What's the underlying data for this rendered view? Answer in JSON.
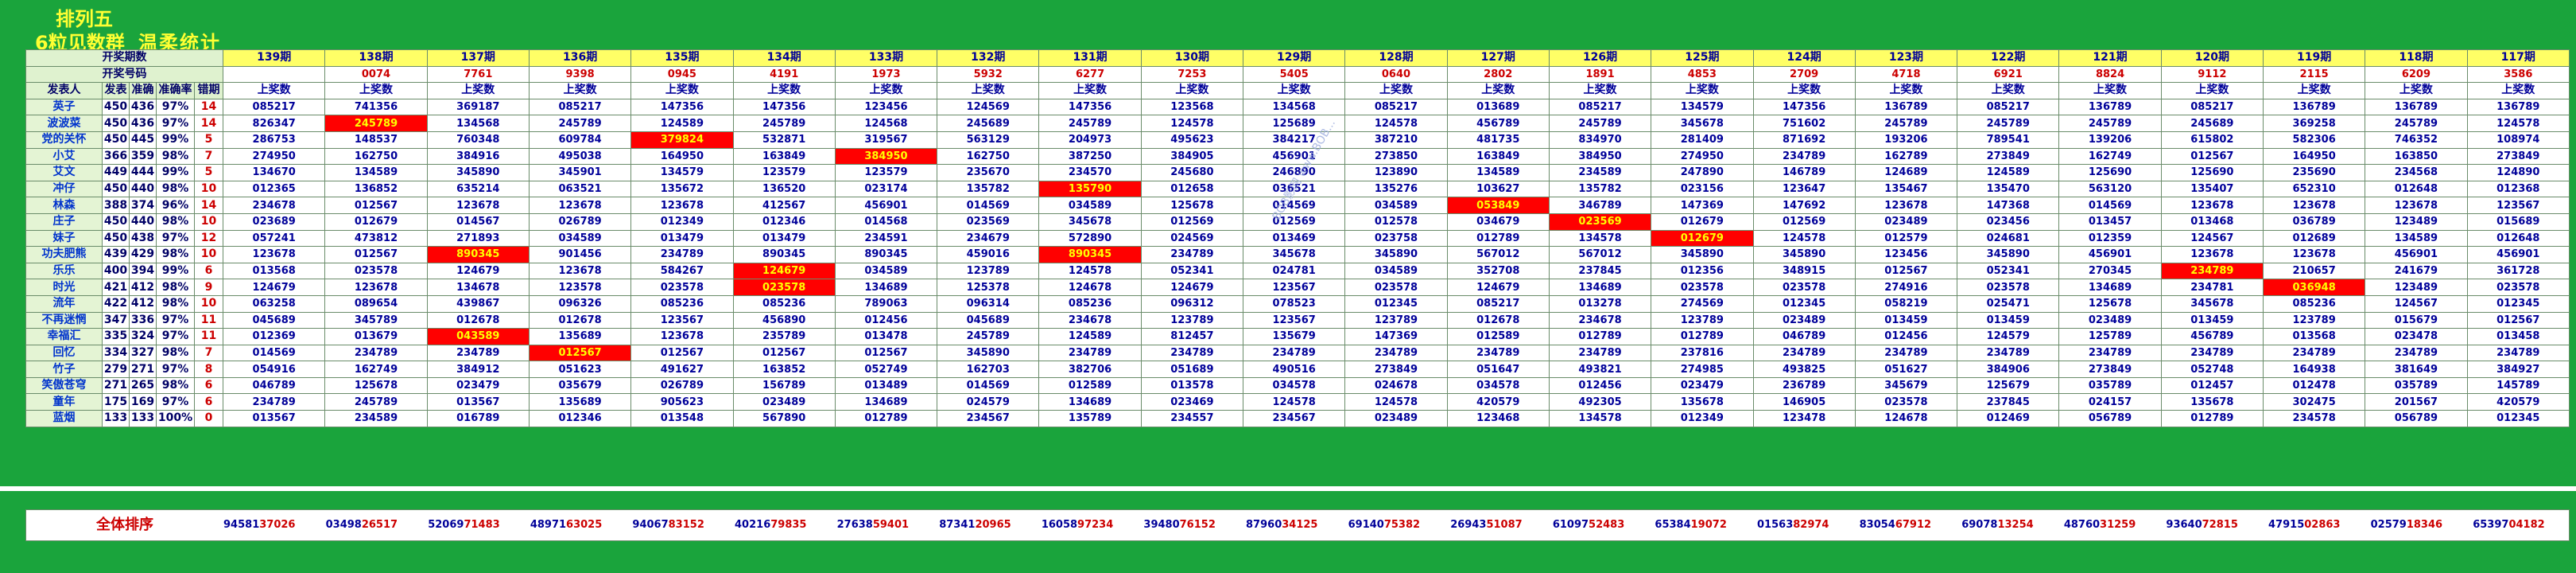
{
  "header": {
    "title_line1": "排列五",
    "title_line2": "6粒见数群",
    "subtitle": "温柔统计"
  },
  "labels": {
    "kaijiang_qishu": "开奖期数",
    "kaijiang_haoma": "开奖号码",
    "publisher": "发表人",
    "stat_cols": [
      "发表",
      "准确",
      "准确率",
      "错期"
    ],
    "shangjiang": "上奖数",
    "overall": "全体排序"
  },
  "periods": [
    "139期",
    "138期",
    "137期",
    "136期",
    "135期",
    "134期",
    "133期",
    "132期",
    "131期",
    "130期",
    "129期",
    "128期",
    "127期",
    "126期",
    "125期",
    "124期",
    "123期",
    "122期",
    "121期",
    "120期",
    "119期",
    "118期",
    "117期"
  ],
  "draws": [
    "",
    "0074",
    "7761",
    "9398",
    "0945",
    "4191",
    "1973",
    "5932",
    "6277",
    "7253",
    "5405",
    "0640",
    "2802",
    "1891",
    "4853",
    "2709",
    "4718",
    "6921",
    "8824",
    "9112",
    "2115",
    "6209",
    "3586"
  ],
  "rows": [
    {
      "name": "英子",
      "s": [
        "450",
        "436",
        "97%",
        "14"
      ],
      "d": [
        "085217",
        "741356",
        "369187",
        "085217",
        "147356",
        "147356",
        "123456",
        "124569",
        "147356",
        "123568",
        "134568",
        "085217",
        "013689",
        "085217",
        "134579",
        "147356",
        "136789",
        "085217",
        "136789",
        "085217",
        "136789",
        "136789",
        "136789"
      ]
    },
    {
      "name": "波波菜",
      "s": [
        "450",
        "436",
        "97%",
        "14"
      ],
      "d": [
        "826347",
        "245789",
        "134568",
        "245789",
        "124589",
        "245789",
        "124568",
        "245689",
        "245789",
        "124578",
        "125689",
        "124578",
        "456789",
        "245789",
        "345678",
        "751602",
        "245789",
        "245789",
        "245789",
        "245689",
        "369258",
        "245789",
        "124578"
      ]
    },
    {
      "name": "党的关怀",
      "s": [
        "450",
        "445",
        "99%",
        "5"
      ],
      "d": [
        "286753",
        "148537",
        "760348",
        "609784",
        "379824",
        "532871",
        "319567",
        "563129",
        "204973",
        "495623",
        "384217",
        "387210",
        "481735",
        "834970",
        "281409",
        "871692",
        "193206",
        "789541",
        "139206",
        "615802",
        "582306",
        "746352",
        "108974"
      ]
    },
    {
      "name": "小艾",
      "s": [
        "366",
        "359",
        "98%",
        "7"
      ],
      "d": [
        "274950",
        "162750",
        "384916",
        "495038",
        "164950",
        "163849",
        "384950",
        "162750",
        "387250",
        "384905",
        "456901",
        "273850",
        "163849",
        "384950",
        "274950",
        "234789",
        "162789",
        "273849",
        "162749",
        "012567",
        "164950",
        "163850",
        "273849"
      ]
    },
    {
      "name": "艾文",
      "s": [
        "449",
        "444",
        "99%",
        "5"
      ],
      "d": [
        "134670",
        "134589",
        "345890",
        "345901",
        "134579",
        "123579",
        "123579",
        "235670",
        "234570",
        "245680",
        "246890",
        "123890",
        "134589",
        "234589",
        "247890",
        "146789",
        "124689",
        "124589",
        "125690",
        "125690",
        "235690",
        "234568",
        "124890"
      ]
    },
    {
      "name": "冲仔",
      "s": [
        "450",
        "440",
        "98%",
        "10"
      ],
      "d": [
        "012365",
        "136852",
        "635214",
        "063521",
        "135672",
        "136520",
        "023174",
        "135782",
        "135790",
        "012658",
        "036521",
        "135276",
        "103627",
        "135782",
        "023156",
        "123647",
        "135467",
        "135470",
        "563120",
        "135407",
        "652310",
        "012648",
        "012368"
      ]
    },
    {
      "name": "林森",
      "s": [
        "388",
        "374",
        "96%",
        "14"
      ],
      "d": [
        "234678",
        "012567",
        "123678",
        "123678",
        "123678",
        "412567",
        "456901",
        "014569",
        "034589",
        "125678",
        "014569",
        "034589",
        "053849",
        "346789",
        "147369",
        "147692",
        "123678",
        "147368",
        "014569",
        "123678",
        "123678",
        "123678",
        "123567"
      ]
    },
    {
      "name": "庄子",
      "s": [
        "450",
        "440",
        "98%",
        "10"
      ],
      "d": [
        "023689",
        "012679",
        "014567",
        "026789",
        "012349",
        "012346",
        "014568",
        "023569",
        "345678",
        "012569",
        "012569",
        "012578",
        "034679",
        "023569",
        "012679",
        "012569",
        "023489",
        "023456",
        "013457",
        "013468",
        "036789",
        "123489",
        "015689"
      ]
    },
    {
      "name": "妹子",
      "s": [
        "450",
        "438",
        "97%",
        "12"
      ],
      "d": [
        "057241",
        "473812",
        "271893",
        "034589",
        "013479",
        "013479",
        "234591",
        "234679",
        "572890",
        "024569",
        "013469",
        "023758",
        "012789",
        "134578",
        "012679",
        "124578",
        "012579",
        "024681",
        "012359",
        "124567",
        "012689",
        "134589",
        "012648"
      ]
    },
    {
      "name": "功夫肥熊",
      "s": [
        "439",
        "429",
        "98%",
        "10"
      ],
      "d": [
        "123678",
        "012567",
        "890345",
        "901456",
        "234789",
        "890345",
        "890345",
        "459016",
        "890345",
        "234789",
        "345678",
        "345890",
        "567012",
        "567012",
        "345890",
        "345890",
        "123456",
        "345890",
        "456901",
        "123678",
        "123678",
        "456901",
        "456901"
      ]
    },
    {
      "name": "乐乐",
      "s": [
        "400",
        "394",
        "99%",
        "6"
      ],
      "d": [
        "013568",
        "023578",
        "124679",
        "123678",
        "584267",
        "124679",
        "034589",
        "123789",
        "124578",
        "052341",
        "024781",
        "034589",
        "352708",
        "237845",
        "012356",
        "348915",
        "012567",
        "052341",
        "270345",
        "234789",
        "210657",
        "241679",
        "361728"
      ]
    },
    {
      "name": "时光",
      "s": [
        "421",
        "412",
        "98%",
        "9"
      ],
      "d": [
        "124679",
        "123678",
        "134678",
        "123578",
        "023578",
        "023578",
        "134689",
        "125378",
        "124678",
        "124679",
        "123567",
        "023578",
        "124679",
        "134689",
        "023578",
        "023578",
        "274916",
        "023578",
        "134689",
        "234781",
        "036948",
        "123489",
        "023578"
      ]
    },
    {
      "name": "流年",
      "s": [
        "422",
        "412",
        "98%",
        "10"
      ],
      "d": [
        "063258",
        "089654",
        "439867",
        "096326",
        "085236",
        "085236",
        "789063",
        "096314",
        "085236",
        "096312",
        "078523",
        "012345",
        "085217",
        "013278",
        "274569",
        "012345",
        "058219",
        "025471",
        "125678",
        "345678",
        "085236",
        "124567",
        "012345"
      ]
    },
    {
      "name": "不再迷惘",
      "s": [
        "347",
        "336",
        "97%",
        "11"
      ],
      "d": [
        "045689",
        "345789",
        "012678",
        "012678",
        "123567",
        "456890",
        "012456",
        "045689",
        "234678",
        "123789",
        "123567",
        "123789",
        "012678",
        "234678",
        "123789",
        "023489",
        "013459",
        "013459",
        "023489",
        "013459",
        "123789",
        "015679",
        "012567"
      ]
    },
    {
      "name": "幸福汇",
      "s": [
        "335",
        "324",
        "97%",
        "11"
      ],
      "d": [
        "012369",
        "013679",
        "043589",
        "135689",
        "123678",
        "235789",
        "013478",
        "245789",
        "124589",
        "812457",
        "135679",
        "147369",
        "012589",
        "012789",
        "012789",
        "046789",
        "012456",
        "124579",
        "125789",
        "456789",
        "013568",
        "023478",
        "013458"
      ]
    },
    {
      "name": "回忆",
      "s": [
        "334",
        "327",
        "98%",
        "7"
      ],
      "d": [
        "014569",
        "234789",
        "234789",
        "012567",
        "012567",
        "012567",
        "012567",
        "345890",
        "234789",
        "234789",
        "234789",
        "234789",
        "234789",
        "234789",
        "237816",
        "234789",
        "234789",
        "234789",
        "234789",
        "234789",
        "234789",
        "234789",
        "234789"
      ]
    },
    {
      "name": "竹子",
      "s": [
        "279",
        "271",
        "97%",
        "8"
      ],
      "d": [
        "054916",
        "162749",
        "384912",
        "051623",
        "491627",
        "163852",
        "052749",
        "162703",
        "382706",
        "051689",
        "490516",
        "273849",
        "051647",
        "493821",
        "274985",
        "493825",
        "051627",
        "384906",
        "273849",
        "052748",
        "164938",
        "381649",
        "384927"
      ]
    },
    {
      "name": "笑傲苍穹",
      "s": [
        "271",
        "265",
        "98%",
        "6"
      ],
      "d": [
        "046789",
        "125678",
        "023479",
        "035679",
        "026789",
        "156789",
        "013489",
        "014569",
        "012589",
        "013578",
        "034578",
        "024678",
        "034578",
        "012456",
        "023479",
        "236789",
        "345679",
        "125679",
        "035789",
        "012457",
        "012478",
        "035789",
        "145789"
      ]
    },
    {
      "name": "童年",
      "s": [
        "175",
        "169",
        "97%",
        "6"
      ],
      "d": [
        "234789",
        "245789",
        "013567",
        "135689",
        "905623",
        "023489",
        "134689",
        "024579",
        "134689",
        "023469",
        "124578",
        "124578",
        "420579",
        "492305",
        "135678",
        "146905",
        "023578",
        "237845",
        "024157",
        "135678",
        "302475",
        "201567",
        "420579"
      ]
    },
    {
      "name": "蓝烟",
      "s": [
        "133",
        "133",
        "100%",
        "0"
      ],
      "d": [
        "013567",
        "234589",
        "016789",
        "012346",
        "013548",
        "567890",
        "012789",
        "234567",
        "135789",
        "234557",
        "234567",
        "023489",
        "123468",
        "134578",
        "012349",
        "123478",
        "124678",
        "012469",
        "056789",
        "012789",
        "234578",
        "056789",
        "012345"
      ]
    }
  ],
  "hits": {
    "1": [
      1
    ],
    "2": [
      4
    ],
    "3": [
      6
    ],
    "5": [
      8
    ],
    "6": [
      12
    ],
    "7": [
      13
    ],
    "8": [
      14
    ],
    "9": [
      2,
      8
    ],
    "10": [
      5,
      19
    ],
    "11": [
      5,
      20
    ],
    "14": [
      2
    ],
    "15": [
      3
    ]
  },
  "overall": [
    {
      "d": "94581",
      "r": "37026"
    },
    {
      "d": "03498",
      "r": "26517"
    },
    {
      "d": "52069",
      "r": "71483"
    },
    {
      "d": "48971",
      "r": "63025"
    },
    {
      "d": "94067",
      "r": "83152"
    },
    {
      "d": "40216",
      "r": "79835"
    },
    {
      "d": "27638",
      "r": "59401"
    },
    {
      "d": "87341",
      "r": "20965"
    },
    {
      "d": "16058",
      "r": "97234"
    },
    {
      "d": "39480",
      "r": "76152"
    },
    {
      "d": "87960",
      "r": "34125"
    },
    {
      "d": "69140",
      "r": "75382"
    },
    {
      "d": "26943",
      "r": "51087"
    },
    {
      "d": "61097",
      "r": "52483"
    },
    {
      "d": "65384",
      "r": "19072"
    },
    {
      "d": "01563",
      "r": "82974"
    },
    {
      "d": "83054",
      "r": "67912"
    },
    {
      "d": "69078",
      "r": "13254"
    },
    {
      "d": "48760",
      "r": "31259"
    },
    {
      "d": "93640",
      "r": "72815"
    },
    {
      "d": "47915",
      "r": "02863"
    },
    {
      "d": "02579",
      "r": "18346"
    },
    {
      "d": "65397",
      "r": "04182"
    }
  ],
  "watermark": "BOB影网 www.BOB..."
}
